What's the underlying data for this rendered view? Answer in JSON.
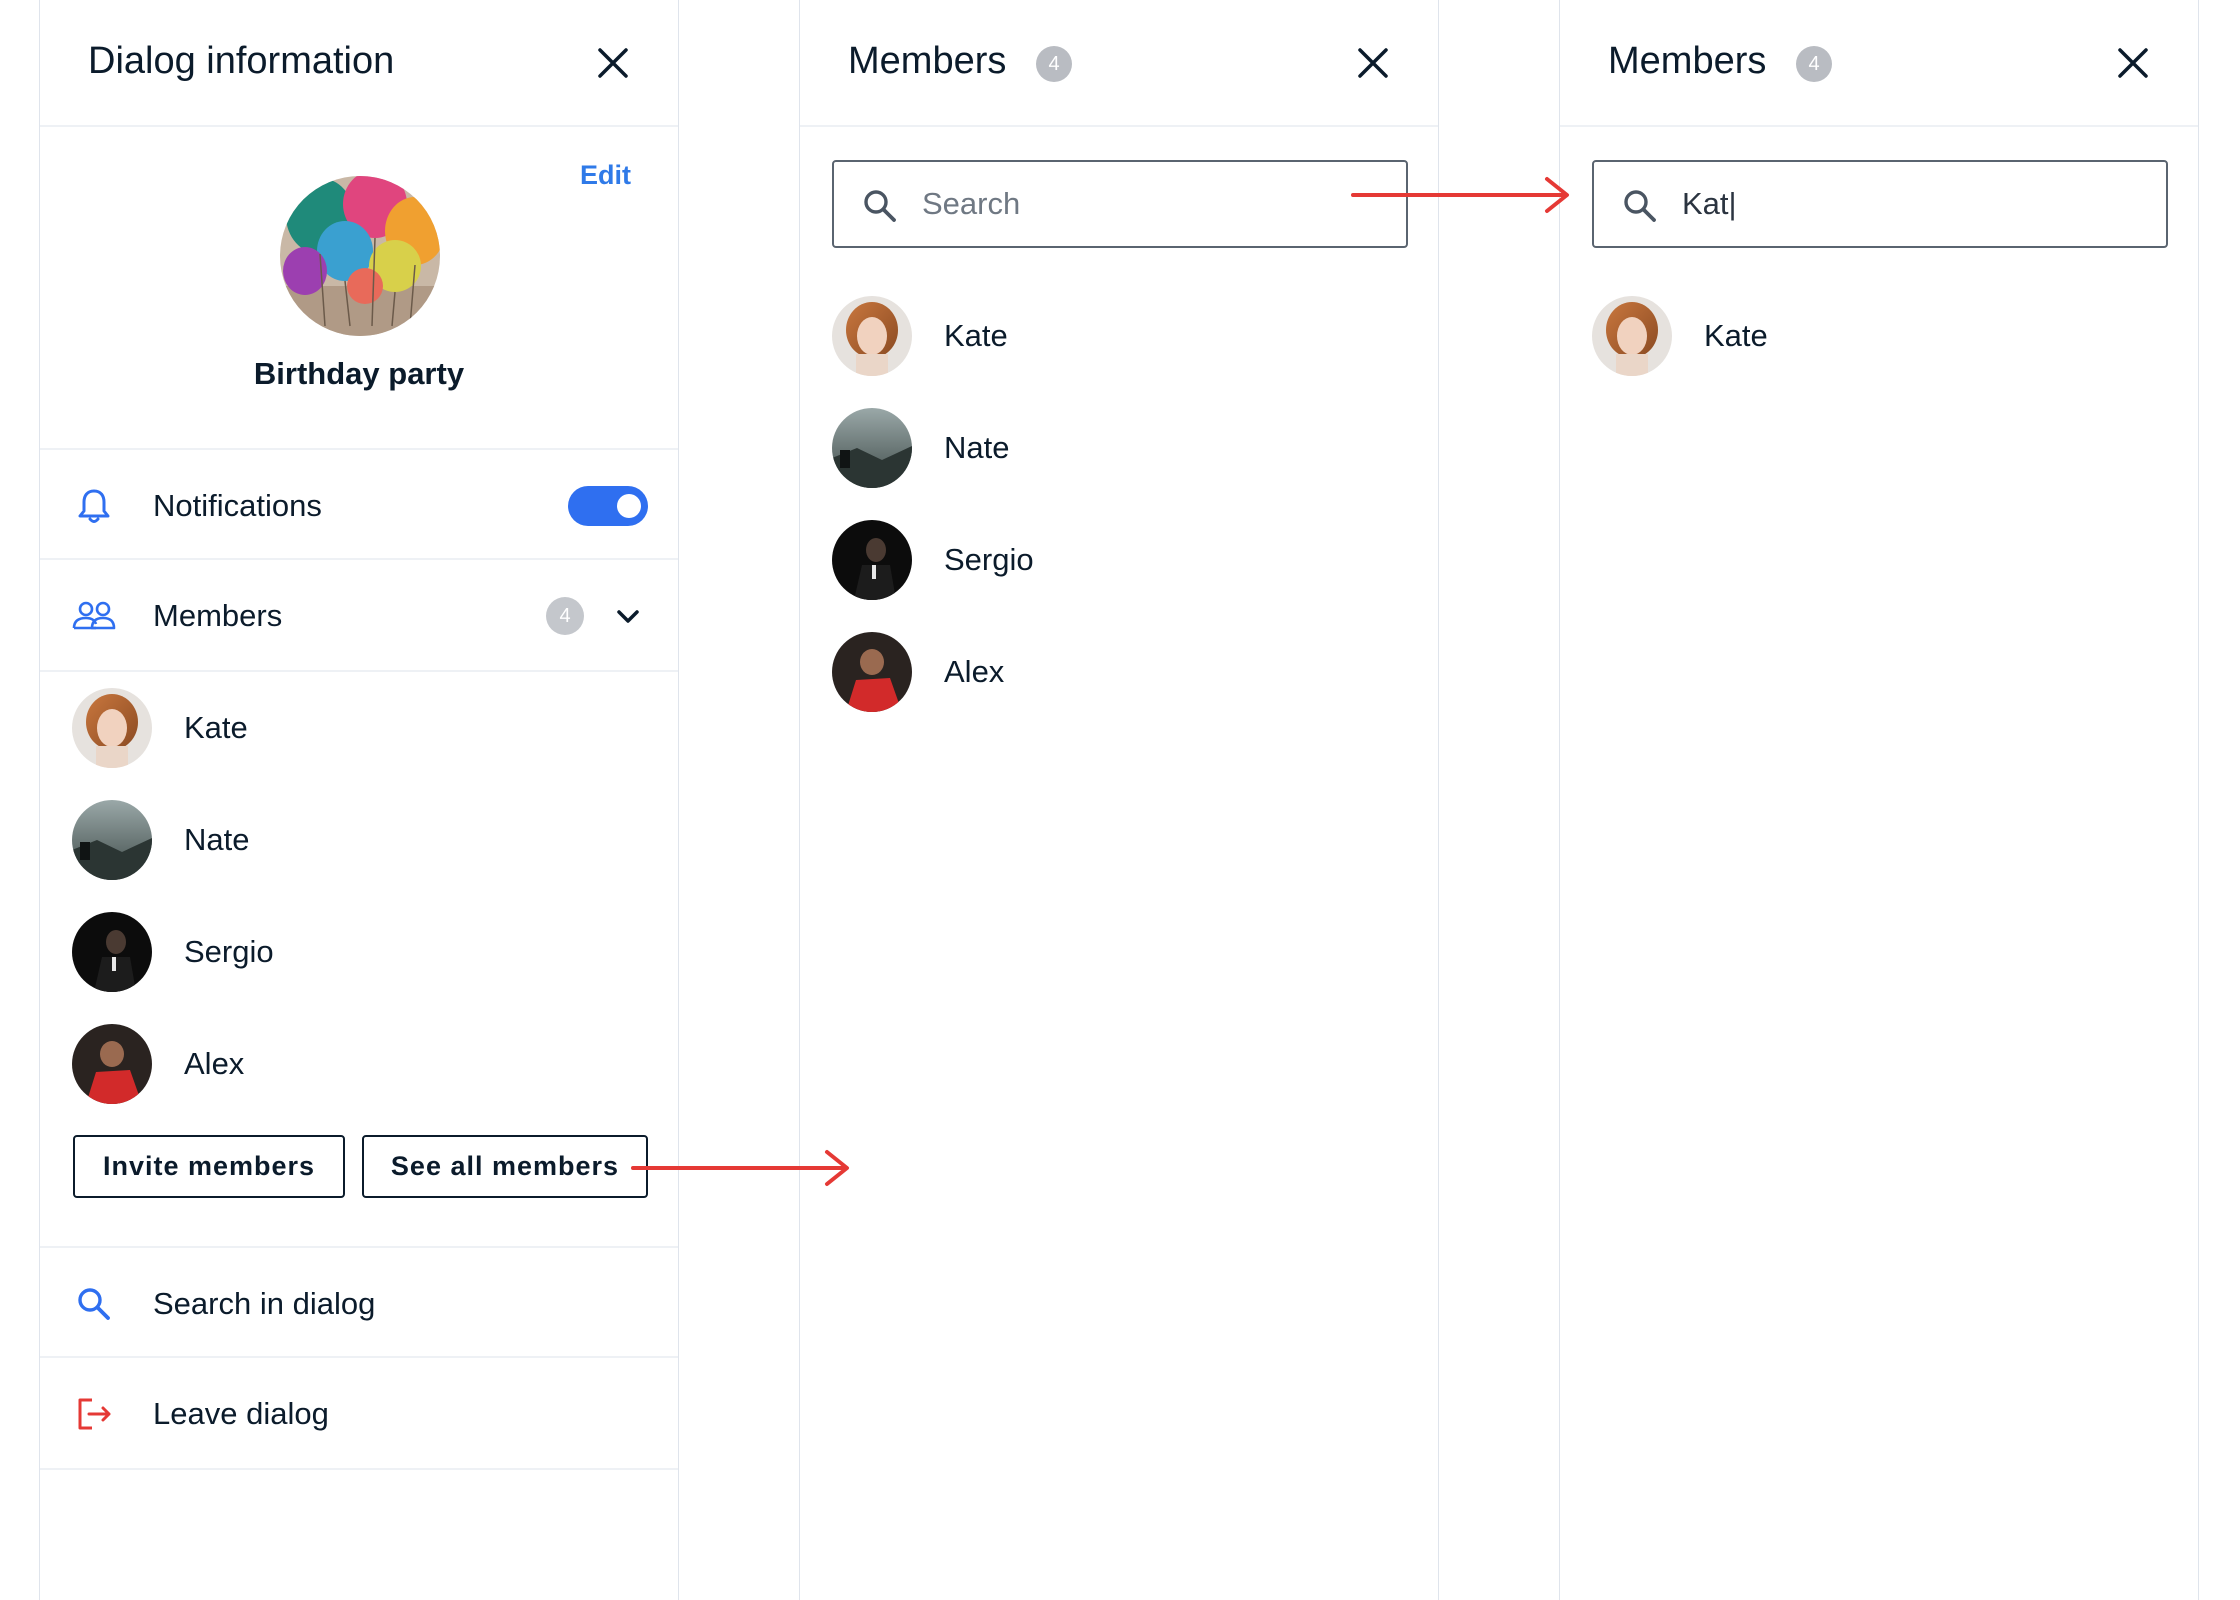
{
  "colors": {
    "accent": "#2f6ff0",
    "link": "#2f7ae8",
    "danger": "#e53935",
    "badge": "#b9bcc2",
    "arrow": "#e53935"
  },
  "dialog_info": {
    "title": "Dialog information",
    "edit_label": "Edit",
    "group_name": "Birthday party",
    "notifications_label": "Notifications",
    "notifications_on": true,
    "members_label": "Members",
    "members_count": "4",
    "members": [
      "Kate",
      "Nate",
      "Sergio",
      "Alex"
    ],
    "invite_button": "Invite members",
    "see_all_button": "See all members",
    "search_in_dialog": "Search in dialog",
    "leave_dialog": "Leave dialog",
    "icons": [
      "close-icon",
      "bell-icon",
      "people-icon",
      "chevron-down-icon",
      "search-icon",
      "leave-icon"
    ]
  },
  "members_panel": {
    "title": "Members",
    "count": "4",
    "search_placeholder": "Search",
    "members": [
      "Kate",
      "Nate",
      "Sergio",
      "Alex"
    ]
  },
  "members_search_panel": {
    "title": "Members",
    "count": "4",
    "search_value": "Kat|",
    "results": [
      "Kate"
    ]
  }
}
